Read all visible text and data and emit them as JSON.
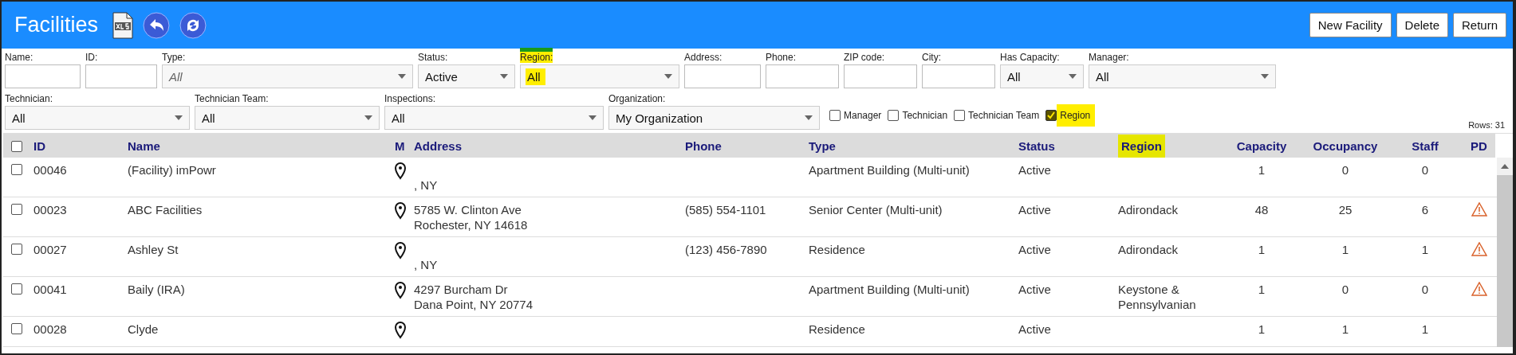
{
  "header": {
    "title": "Facilities",
    "buttons": [
      "New Facility",
      "Delete",
      "Return"
    ]
  },
  "filters_row_1": [
    {
      "label": "Name:",
      "kind": "text",
      "highlighted": false
    },
    {
      "label": "ID:",
      "kind": "text",
      "highlighted": false
    },
    {
      "label": "Type:",
      "kind": "select",
      "placeholder": "All",
      "highlighted": false
    },
    {
      "label": "Status:",
      "kind": "select",
      "value": "Active",
      "highlighted": false
    },
    {
      "label": "Region:",
      "kind": "select",
      "value": "All",
      "highlighted": true
    },
    {
      "label": "Address:",
      "kind": "text",
      "highlighted": false
    },
    {
      "label": "Phone:",
      "kind": "text",
      "highlighted": false
    },
    {
      "label": "ZIP code:",
      "kind": "text",
      "highlighted": false
    },
    {
      "label": "City:",
      "kind": "text",
      "highlighted": false
    },
    {
      "label": "Has Capacity:",
      "kind": "select",
      "value": "All",
      "highlighted": false
    },
    {
      "label": "Manager:",
      "kind": "select",
      "value": "All",
      "highlighted": false
    }
  ],
  "filters_row_2": [
    {
      "label": "Technician:",
      "kind": "select",
      "value": "All",
      "highlighted": false
    },
    {
      "label": "Technician Team:",
      "kind": "select",
      "value": "All",
      "highlighted": false
    },
    {
      "label": "Inspections:",
      "kind": "select",
      "value": "All",
      "highlighted": false
    },
    {
      "label": "Organization:",
      "kind": "select",
      "value": "My Organization",
      "highlighted": false
    }
  ],
  "column_toggles": [
    {
      "label": "Manager",
      "checked": false,
      "highlighted": false
    },
    {
      "label": "Technician",
      "checked": false,
      "highlighted": false
    },
    {
      "label": "Technician Team",
      "checked": false,
      "highlighted": false
    },
    {
      "label": "Region",
      "checked": true,
      "highlighted": true
    }
  ],
  "row_count": "Rows: 31",
  "table": {
    "select_all_checked": false,
    "columns": [
      {
        "label": "ID",
        "highlighted": false
      },
      {
        "label": "Name",
        "highlighted": false
      },
      {
        "label": "M",
        "highlighted": false
      },
      {
        "label": "Address",
        "highlighted": false
      },
      {
        "label": "Phone",
        "highlighted": false
      },
      {
        "label": "Type",
        "highlighted": false
      },
      {
        "label": "Status",
        "highlighted": false
      },
      {
        "label": "Region",
        "highlighted": true
      },
      {
        "label": "Capacity",
        "highlighted": false
      },
      {
        "label": "Occupancy",
        "highlighted": false
      },
      {
        "label": "Staff",
        "highlighted": false
      },
      {
        "label": "PD",
        "highlighted": false
      }
    ],
    "rows": [
      {
        "checked": false,
        "id": "00046",
        "name": "(Facility) imPowr",
        "address": {
          "line_2": ", NY"
        },
        "phone": "",
        "type": "Apartment Building (Multi-unit)",
        "status": "Active",
        "region": "",
        "capacity": "1",
        "occupancy": "0",
        "staff": "0",
        "warning": false
      },
      {
        "checked": false,
        "id": "00023",
        "name": "ABC Facilities",
        "address": {
          "line_1": "5785 W. Clinton Ave",
          "line_2": "Rochester, NY 14618"
        },
        "phone": "(585) 554-1101",
        "type": "Senior Center (Multi-unit)",
        "status": "Active",
        "region": "Adirondack",
        "capacity": "48",
        "occupancy": "25",
        "staff": "6",
        "warning": true
      },
      {
        "checked": false,
        "id": "00027",
        "name": "Ashley St",
        "address": {
          "line_2": ", NY"
        },
        "phone": "(123) 456-7890",
        "type": "Residence",
        "status": "Active",
        "region": "Adirondack",
        "capacity": "1",
        "occupancy": "1",
        "staff": "1",
        "warning": true
      },
      {
        "checked": false,
        "id": "00041",
        "name": "Baily (IRA)",
        "address": {
          "line_1": "4297 Burcham Dr",
          "line_2": "Dana Point, NY 20774"
        },
        "phone": "",
        "type": "Apartment Building (Multi-unit)",
        "status": "Active",
        "region": "Keystone & Pennsylvanian",
        "capacity": "1",
        "occupancy": "0",
        "staff": "0",
        "warning": true
      },
      {
        "checked": false,
        "id": "00028",
        "name": "Clyde",
        "address": {},
        "phone": "",
        "type": "Residence",
        "status": "Active",
        "region": "",
        "capacity": "1",
        "occupancy": "1",
        "staff": "1",
        "warning": false
      }
    ]
  }
}
